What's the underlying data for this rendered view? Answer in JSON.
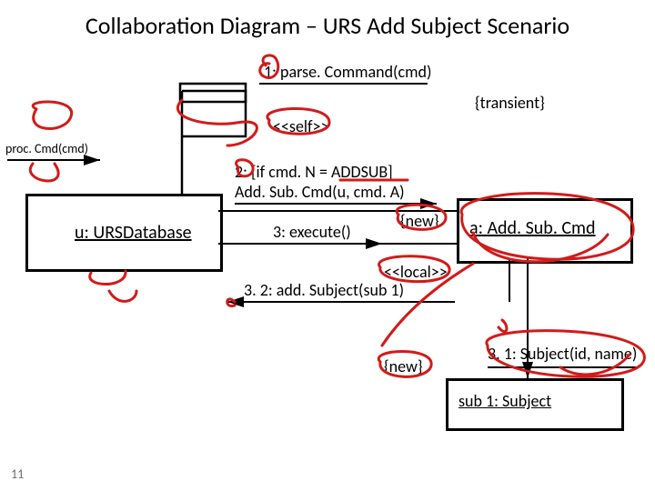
{
  "title": "Collaboration Diagram – URS Add Subject Scenario",
  "slide_number": "11",
  "messages": {
    "m1": "1: parse. Command(cmd)",
    "m2_guard": "2: [if cmd. N = ADDSUB]",
    "m2_call": "Add. Sub. Cmd(u, cmd. A)",
    "m3": "3: execute()",
    "m3_1": "3. 1: Subject(id, name)",
    "m3_2": "3. 2: add. Subject(sub 1)"
  },
  "stereotypes": {
    "self": "<<self>>",
    "local": "<<local>>"
  },
  "constraints": {
    "transient": "{transient}",
    "new1": "{new}",
    "new2": "{new}"
  },
  "objects": {
    "actor_msg": "proc. Cmd(cmd)",
    "u": "u: URSDatabase",
    "a": "a: Add. Sub. Cmd",
    "sub1": "sub 1: Subject"
  },
  "chart_data": {
    "type": "diagram",
    "diagram_kind": "UML collaboration diagram",
    "title": "Collaboration Diagram – URS Add Subject Scenario",
    "objects": [
      {
        "id": "u",
        "label": "u:URSDatabase"
      },
      {
        "id": "a",
        "label": "a:Add.Sub.Cmd",
        "constraint": "{transient}"
      },
      {
        "id": "sub1",
        "label": "sub1:Subject",
        "constraint": "{new}"
      }
    ],
    "messages": [
      {
        "seq": "",
        "from": "actor",
        "to": "u",
        "label": "proc.Cmd(cmd)"
      },
      {
        "seq": "1",
        "from": "u",
        "to": "u",
        "label": "parse.Command(cmd)",
        "stereotype": "<<self>>"
      },
      {
        "seq": "2",
        "from": "u",
        "to": "a",
        "label": "Add.Sub.Cmd(u, cmd.A)",
        "guard": "[if cmd.N = ADDSUB]",
        "constraint": "{new}"
      },
      {
        "seq": "3",
        "from": "u",
        "to": "a",
        "label": "execute()"
      },
      {
        "seq": "3.1",
        "from": "a",
        "to": "sub1",
        "label": "Subject(id, name)",
        "constraint": "{new}"
      },
      {
        "seq": "3.2",
        "from": "a",
        "to": "u",
        "label": "add.Subject(sub1)",
        "stereotype": "<<local>>"
      }
    ]
  }
}
